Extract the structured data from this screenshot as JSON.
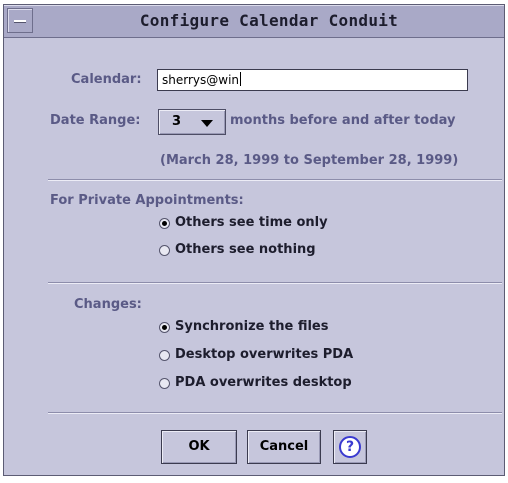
{
  "window": {
    "title": "Configure Calendar Conduit"
  },
  "calendar": {
    "label": "Calendar:",
    "value": "sherrys@win"
  },
  "date_range": {
    "label": "Date Range:",
    "selected": "3",
    "suffix": "months before and after today",
    "span": "(March 28, 1999 to September 28, 1999)"
  },
  "private_appointments": {
    "label": "For Private Appointments:",
    "options": [
      {
        "label": "Others see time only",
        "selected": true
      },
      {
        "label": "Others see nothing",
        "selected": false
      }
    ]
  },
  "changes": {
    "label": "Changes:",
    "options": [
      {
        "label": "Synchronize the files",
        "selected": true
      },
      {
        "label": "Desktop overwrites PDA",
        "selected": false
      },
      {
        "label": "PDA overwrites desktop",
        "selected": false
      }
    ]
  },
  "buttons": {
    "ok": "OK",
    "cancel": "Cancel",
    "help_glyph": "?"
  },
  "icons": {
    "window_menu": "window-menu-icon",
    "dropdown": "dropdown-arrow-icon",
    "help": "help-icon"
  },
  "colors": {
    "window_bg": "#c6c6dc",
    "titlebar_bg": "#a9a9c7",
    "label_text": "#5a5a86",
    "help_accent": "#3a3ad0"
  }
}
